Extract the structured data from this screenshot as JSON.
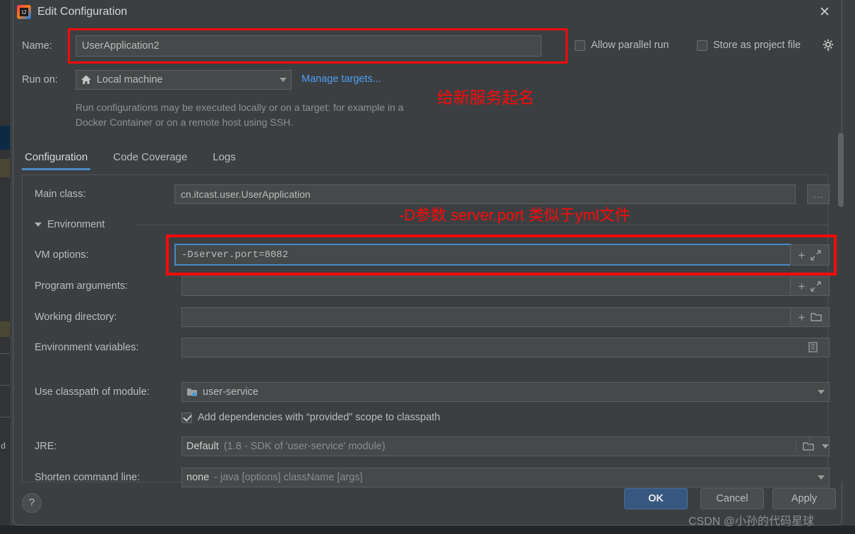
{
  "window": {
    "title": "Edit Configuration",
    "app_icon": "intellij-idea-icon",
    "close_icon": "close-icon"
  },
  "name_row": {
    "label": "Name:",
    "value": "UserApplication2",
    "placeholder": "Name"
  },
  "top_options": {
    "allow_parallel_run": {
      "label": "Allow parallel run",
      "checked": false
    },
    "store_as_project_file": {
      "label": "Store as project file",
      "checked": false
    },
    "gear_icon": "gear-icon"
  },
  "run_on": {
    "label": "Run on:",
    "value": "Local machine",
    "icon": "home-icon",
    "manage_link": "Manage targets...",
    "hint": "Run configurations may be executed locally or on a target: for example in a Docker Container or on a remote host using SSH."
  },
  "tabs": [
    {
      "label": "Configuration",
      "active": true
    },
    {
      "label": "Code Coverage",
      "active": false
    },
    {
      "label": "Logs",
      "active": false
    }
  ],
  "fields": {
    "main_class": {
      "label": "Main class:",
      "value": "cn.itcast.user.UserApplication",
      "browse_label": "..."
    },
    "environment_section": {
      "label": "Environment",
      "expanded": true
    },
    "vm_options": {
      "label": "VM options:",
      "value": "-Dserver.port=8082",
      "focused": true
    },
    "program_arguments": {
      "label": "Program arguments:",
      "value": ""
    },
    "working_directory": {
      "label": "Working directory:",
      "value": ""
    },
    "environment_variables": {
      "label": "Environment variables:",
      "value": ""
    },
    "use_classpath_of_module": {
      "label": "Use classpath of module:",
      "value": "user-service"
    },
    "add_dependencies": {
      "label": "Add dependencies with “provided” scope to classpath",
      "checked": true
    },
    "jre": {
      "label": "JRE:",
      "value": "Default",
      "detail": "(1.8 - SDK of 'user-service' module)"
    },
    "shorten_command_line": {
      "label": "Shorten command line:",
      "value": "none",
      "detail": "- java [options] className [args]"
    }
  },
  "footer": {
    "help_label": "?",
    "ok_label": "OK",
    "cancel_label": "Cancel",
    "apply_label": "Apply"
  },
  "annotations": {
    "name_note": "给新服务起名",
    "vm_note": "-D参数 server.port 类似于yml文件",
    "box_color": "#fb0a0a"
  },
  "watermark": "CSDN @小孙的代码星球",
  "colors": {
    "dialog_bg": "#3c3f41",
    "field_bg": "#45494a",
    "accent_blue": "#4e88c7",
    "link_blue": "#4d9ef5",
    "ok_button": "#365880",
    "annotation_red": "#fb0a0a"
  }
}
